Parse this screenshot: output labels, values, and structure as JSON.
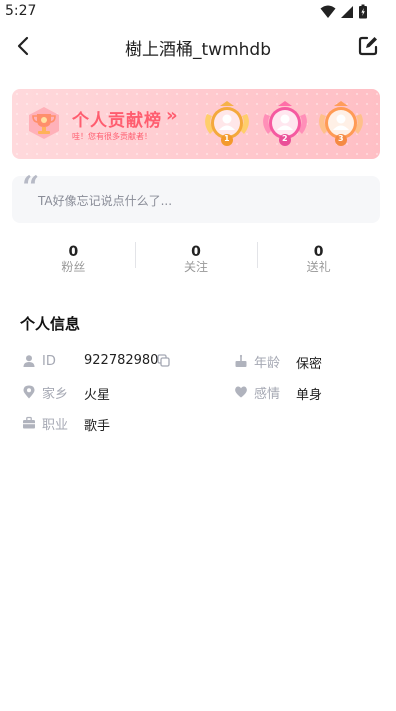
{
  "status_bar": {
    "time": "5:27"
  },
  "nav": {
    "title": "樹上酒桶_twmhdb"
  },
  "banner": {
    "title": "个人贡献榜",
    "arrows": "»",
    "subtitle": "哇！您有很多贡献者！",
    "medal_ranks": [
      "1",
      "2",
      "3"
    ]
  },
  "signature": {
    "quote_mark": "“",
    "text": "TA好像忘记说点什么了..."
  },
  "stats": [
    {
      "value": "0",
      "label": "粉丝"
    },
    {
      "value": "0",
      "label": "关注"
    },
    {
      "value": "0",
      "label": "送礼"
    }
  ],
  "profile": {
    "section_title": "个人信息",
    "id_label": "ID",
    "id_value": "922782980",
    "age_label": "年龄",
    "age_value": "保密",
    "hometown_label": "家乡",
    "hometown_value": "火星",
    "relationship_label": "感情",
    "relationship_value": "单身",
    "job_label": "职业",
    "job_value": "歌手"
  },
  "colors": {
    "accent": "#ff5d6f",
    "banner_bg": "#ffcdd2",
    "muted": "#a5a8b3"
  }
}
